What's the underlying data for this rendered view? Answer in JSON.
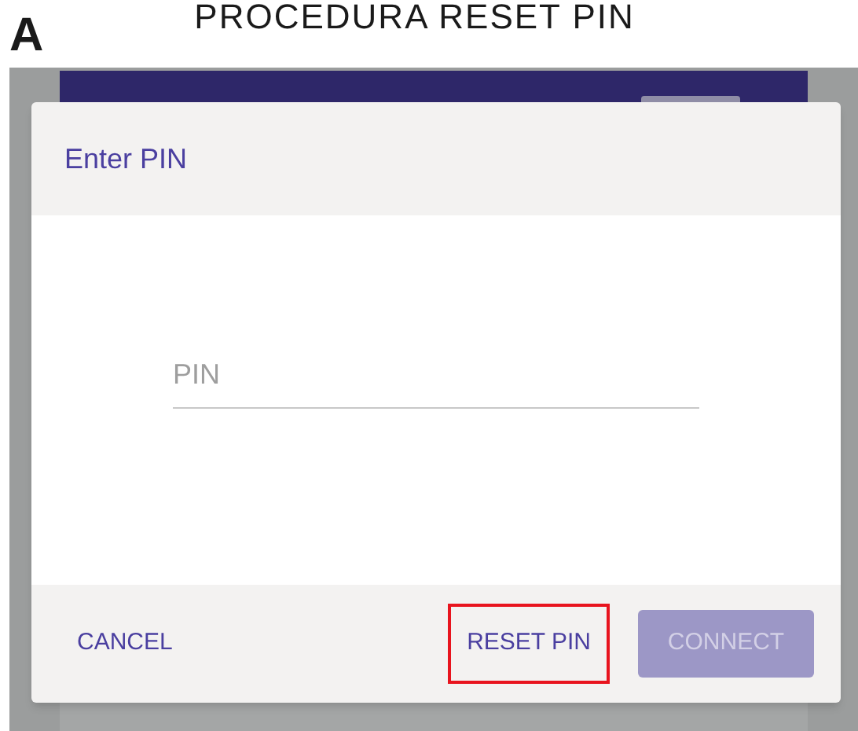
{
  "figure": {
    "title": "PROCEDURA RESET PIN",
    "panel_label": "A"
  },
  "dialog": {
    "title": "Enter PIN",
    "pin_field": {
      "placeholder": "PIN"
    },
    "buttons": [
      {
        "kind": "text",
        "label": "CANCEL",
        "disabled": false,
        "highlighted": false
      },
      {
        "kind": "text",
        "label": "RESET PIN",
        "disabled": false,
        "highlighted": true
      },
      {
        "kind": "filled",
        "label": "CONNECT",
        "disabled": true,
        "highlighted": false
      }
    ]
  }
}
